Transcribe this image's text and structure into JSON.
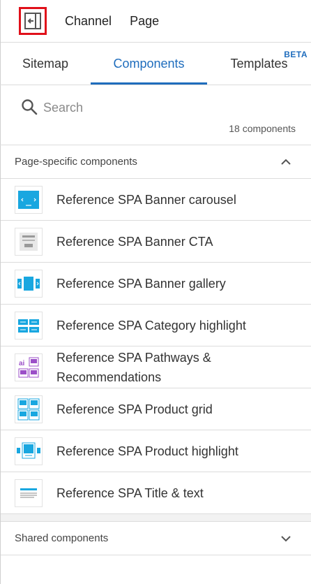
{
  "topbar": {
    "channel_label": "Channel",
    "page_label": "Page"
  },
  "tabs": [
    {
      "label": "Sitemap"
    },
    {
      "label": "Components",
      "badge": ""
    },
    {
      "label": "Templates",
      "badge": "BETA"
    }
  ],
  "search": {
    "placeholder": "Search",
    "value": "",
    "count_text": "18 components"
  },
  "page_specific": {
    "header": "Page-specific components",
    "expanded": true,
    "items": [
      {
        "name": "Reference SPA Banner carousel",
        "icon": "banner-carousel-icon"
      },
      {
        "name": "Reference SPA Banner CTA",
        "icon": "banner-cta-icon"
      },
      {
        "name": "Reference SPA Banner gallery",
        "icon": "banner-gallery-icon"
      },
      {
        "name": "Reference SPA Category highlight",
        "icon": "category-highlight-icon"
      },
      {
        "name": "Reference SPA Pathways & Recommendations",
        "icon": "pathways-recommendations-icon"
      },
      {
        "name": "Reference SPA Product grid",
        "icon": "product-grid-icon"
      },
      {
        "name": "Reference SPA Product highlight",
        "icon": "product-highlight-icon"
      },
      {
        "name": "Reference SPA Title & text",
        "icon": "title-text-icon"
      }
    ]
  },
  "shared": {
    "header": "Shared components",
    "expanded": false
  },
  "colors": {
    "accent": "#1f6dbd",
    "icon_blue": "#19a7e0",
    "icon_purple": "#9b4fc8",
    "highlight_border": "#e0101a"
  }
}
